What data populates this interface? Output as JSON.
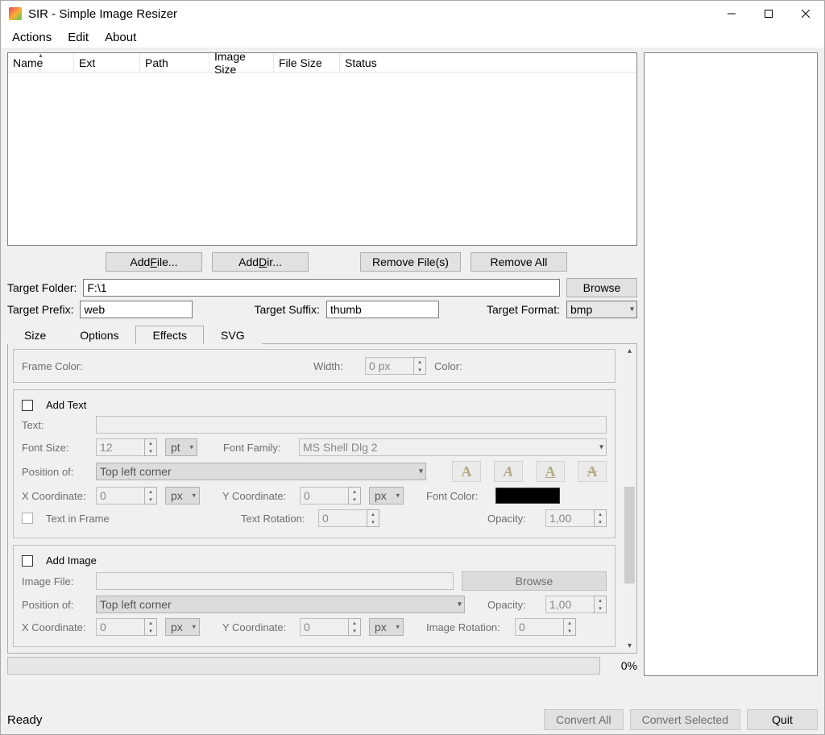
{
  "window": {
    "title": "SIR - Simple Image Resizer"
  },
  "menu": {
    "actions": "Actions",
    "edit": "Edit",
    "about": "About"
  },
  "table": {
    "columns": {
      "name": "Name",
      "ext": "Ext",
      "path": "Path",
      "image_size": "Image Size",
      "file_size": "File Size",
      "status": "Status"
    }
  },
  "buttons": {
    "add_file": "Add File...",
    "add_file_ul": "F",
    "add_dir": "Add Dir...",
    "add_dir_ul": "D",
    "remove_files": "Remove File(s)",
    "remove_all": "Remove All",
    "browse": "Browse"
  },
  "target": {
    "folder_label": "Target Folder:",
    "folder_value": "F:\\1",
    "prefix_label": "Target Prefix:",
    "prefix_value": "web",
    "suffix_label": "Target Suffix:",
    "suffix_value": "thumb",
    "format_label": "Target Format:",
    "format_value": "bmp"
  },
  "tabs": {
    "size": "Size",
    "options": "Options",
    "effects": "Effects",
    "svg": "SVG"
  },
  "effects": {
    "frame": {
      "color_label": "Frame Color:",
      "width_label": "Width:",
      "width_value": "0 px",
      "out_color_label": "Color:"
    },
    "add_text": {
      "title": "Add Text",
      "text_label": "Text:",
      "text_value": "",
      "font_size_label": "Font Size:",
      "font_size_value": "12",
      "font_size_unit": "pt",
      "font_family_label": "Font Family:",
      "font_family_value": "MS Shell Dlg 2",
      "position_label": "Position of:",
      "position_value": "Top left corner",
      "x_label": "X Coordinate:",
      "x_value": "0",
      "x_unit": "px",
      "y_label": "Y Coordinate:",
      "y_value": "0",
      "y_unit": "px",
      "font_color_label": "Font Color:",
      "text_in_frame_label": "Text in Frame",
      "rotation_label": "Text Rotation:",
      "rotation_value": "0",
      "opacity_label": "Opacity:",
      "opacity_value": "1,00"
    },
    "add_image": {
      "title": "Add Image",
      "file_label": "Image File:",
      "file_value": "",
      "browse": "Browse",
      "position_label": "Position of:",
      "position_value": "Top left corner",
      "opacity_label": "Opacity:",
      "opacity_value": "1,00",
      "x_label": "X Coordinate:",
      "x_value": "0",
      "x_unit": "px",
      "y_label": "Y Coordinate:",
      "y_value": "0",
      "y_unit": "px",
      "rotation_label": "Image Rotation:",
      "rotation_value": "0"
    }
  },
  "progress": {
    "percent": "0%"
  },
  "status": {
    "ready": "Ready",
    "convert_all": "Convert All",
    "convert_all_ul": "A",
    "convert_selected": "Convert Selected",
    "quit": "Quit"
  }
}
